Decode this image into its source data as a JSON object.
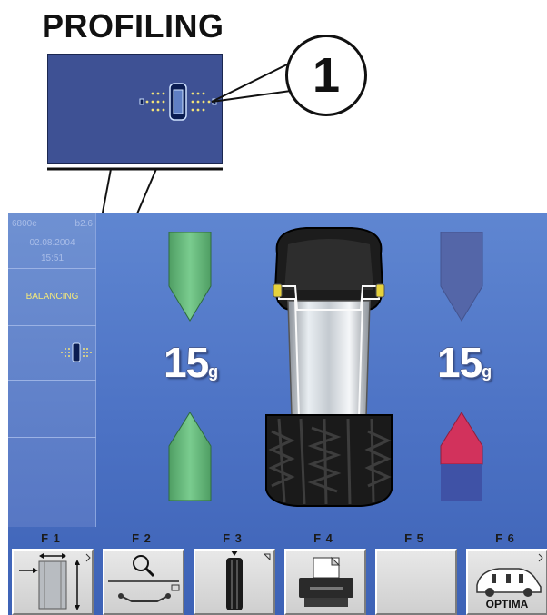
{
  "header": {
    "title": "PROFILING"
  },
  "callout": {
    "number": "1"
  },
  "sidebar": {
    "machine_code": "6800e",
    "version": "b2.6",
    "date": "02.08.2004",
    "time": "15:51",
    "mode": "BALANCING"
  },
  "weights": {
    "left": {
      "value": "15",
      "unit": "g"
    },
    "right": {
      "value": "15",
      "unit": "g"
    }
  },
  "function_keys": [
    {
      "label": "F 1",
      "icon": "wheel-dimensions-icon"
    },
    {
      "label": "F 2",
      "icon": "search-options-icon"
    },
    {
      "label": "F 3",
      "icon": "tyre-tread-icon"
    },
    {
      "label": "F 4",
      "icon": "printer-icon"
    },
    {
      "label": "F 5",
      "icon": ""
    },
    {
      "label": "F 6",
      "icon": "optima-icon",
      "caption": "OPTIMA"
    }
  ],
  "colors": {
    "screen_bg": "#4d73c5",
    "arrow_green": "#62b47a",
    "arrow_red": "#d2325c",
    "arrow_inactive": "#5466a8",
    "mode_text": "#f4e97a"
  }
}
